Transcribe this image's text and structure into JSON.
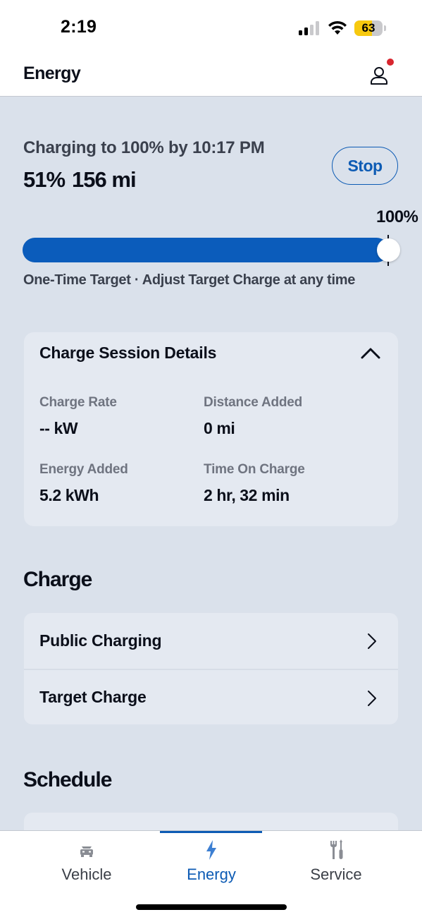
{
  "status_bar": {
    "time": "2:19",
    "battery_level": 63,
    "battery_text": "63",
    "signal_bars_active": 2,
    "signal_bars_total": 4
  },
  "header": {
    "title": "Energy",
    "profile_icon": "person-icon",
    "has_notification": true
  },
  "charging": {
    "status_text": "Charging to 100% by 10:17 PM",
    "battery_percent": "51%",
    "range": "156 mi",
    "stop_label": "Stop",
    "target_label": "100%",
    "target_percent": 100,
    "bar_fill_percent": 100,
    "note": "One-Time Target · Adjust Target Charge at any time"
  },
  "session": {
    "title": "Charge Session Details",
    "expanded": true,
    "stats": [
      {
        "label": "Charge Rate",
        "value": "-- kW"
      },
      {
        "label": "Distance Added",
        "value": "0 mi"
      },
      {
        "label": "Energy Added",
        "value": "5.2 kWh"
      },
      {
        "label": "Time On Charge",
        "value": "2 hr, 32 min"
      }
    ]
  },
  "charge_section": {
    "heading": "Charge",
    "items": [
      {
        "label": "Public Charging"
      },
      {
        "label": "Target Charge"
      }
    ]
  },
  "schedule_section": {
    "heading": "Schedule"
  },
  "tabs": [
    {
      "label": "Vehicle",
      "icon": "car-icon",
      "active": false
    },
    {
      "label": "Energy",
      "icon": "lightning-icon",
      "active": true
    },
    {
      "label": "Service",
      "icon": "tools-icon",
      "active": false
    }
  ],
  "colors": {
    "accent": "#0d5bb4",
    "background": "#dae1eb",
    "card": "#e4e9f1",
    "notification": "#d8262f",
    "battery": "#f7c90f"
  }
}
